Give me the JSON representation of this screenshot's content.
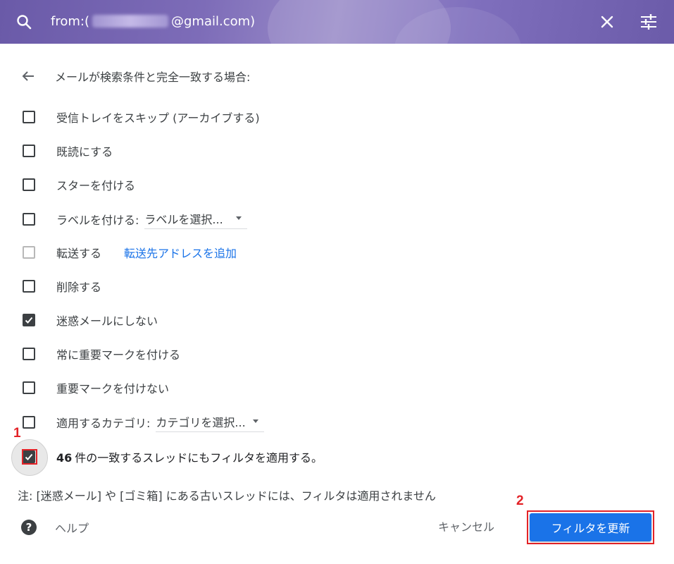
{
  "search": {
    "query_prefix": "from:(",
    "query_suffix": "@gmail.com)"
  },
  "header": {
    "title": "メールが検索条件と完全一致する場合:"
  },
  "options": {
    "skip_inbox": "受信トレイをスキップ (アーカイブする)",
    "mark_read": "既読にする",
    "star": "スターを付ける",
    "apply_label": "ラベルを付ける:",
    "label_select": "ラベルを選択...",
    "forward": "転送する",
    "forward_link": "転送先アドレスを追加",
    "delete": "削除する",
    "never_spam": "迷惑メールにしない",
    "always_important": "常に重要マークを付ける",
    "never_important": "重要マークを付けない",
    "category": "適用するカテゴリ:",
    "category_select": "カテゴリを選択...",
    "never_spam_checked": true
  },
  "apply_existing": {
    "count": "46",
    "label": "件の一致するスレッドにもフィルタを適用する。",
    "checked": true
  },
  "note": "注: [迷惑メール] や [ゴミ箱] にある古いスレッドには、フィルタは適用されません",
  "footer": {
    "help": "ヘルプ",
    "cancel": "キャンセル",
    "update": "フィルタを更新"
  },
  "annotations": {
    "step1": "1",
    "step2": "2"
  },
  "colors": {
    "header_bg": "#7a69b8",
    "primary": "#1a73e8",
    "annotation": "#e32227",
    "link": "#1a73e8"
  }
}
